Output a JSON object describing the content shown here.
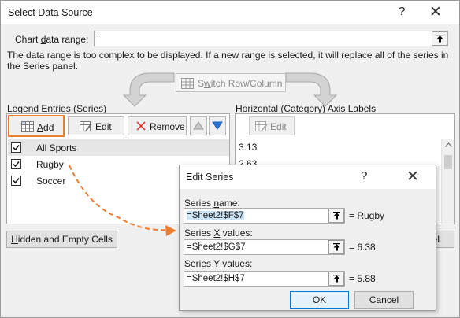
{
  "dialog": {
    "title": "Select Data Source",
    "help_icon": "?",
    "close_icon": "✕",
    "chart_range_label_pre": "Chart ",
    "chart_range_label_u": "d",
    "chart_range_label_post": "ata range:",
    "chart_range_value": "",
    "note": "The data range is too complex to be displayed. If a new range is selected, it will replace all of the series in the Series panel.",
    "switch_label_pre": "S",
    "switch_label_u": "w",
    "switch_label_post": "itch Row/Column",
    "legend_header_pre": "Legend Entries (",
    "legend_header_u": "S",
    "legend_header_post": "eries)",
    "axis_header_pre": "Horizontal (",
    "axis_header_u": "C",
    "axis_header_post": "ategory) Axis Labels",
    "add_label_u": "A",
    "add_label_post": "dd",
    "edit_label_u": "E",
    "edit_label_post": "dit",
    "remove_label_u": "R",
    "remove_label_post": "emove",
    "axis_edit_label_u": "E",
    "axis_edit_label_post": "dit",
    "series": [
      {
        "name": "All Sports",
        "checked": true
      },
      {
        "name": "Rugby",
        "checked": true
      },
      {
        "name": "Soccer",
        "checked": true
      }
    ],
    "axis_labels": [
      "3.13",
      "2.63"
    ],
    "hidden_cells_label_u": "H",
    "hidden_cells_label_post": "idden and Empty Cells",
    "cancel_label": "ancel"
  },
  "edit_series": {
    "title": "Edit Series",
    "help_icon": "?",
    "close_icon": "✕",
    "name_label_pre": "Series ",
    "name_label_u": "n",
    "name_label_post": "ame:",
    "name_value": "=Sheet2!$F$7",
    "name_result": "= Rugby",
    "x_label_pre": "Series ",
    "x_label_u": "X",
    "x_label_post": " values:",
    "x_value": "=Sheet2!$G$7",
    "x_result": "= 6.38",
    "y_label_pre": "Series ",
    "y_label_u": "Y",
    "y_label_post": " values:",
    "y_value": "=Sheet2!$H$7",
    "y_result": "= 5.88",
    "ok_label": "OK",
    "cancel_label": "Cancel"
  },
  "colors": {
    "annotation": "#ed7d31",
    "selection": "#cce4f7",
    "remove_icon": "#e34040",
    "arrow_icons": "#2e75d6"
  },
  "icons": [
    "collapse-range-icon",
    "switch-row-column-icon",
    "add-series-icon",
    "edit-series-icon",
    "remove-x-icon",
    "move-up-icon",
    "move-down-icon",
    "checkbox-checked-icon",
    "dashed-arrow-annotation"
  ]
}
